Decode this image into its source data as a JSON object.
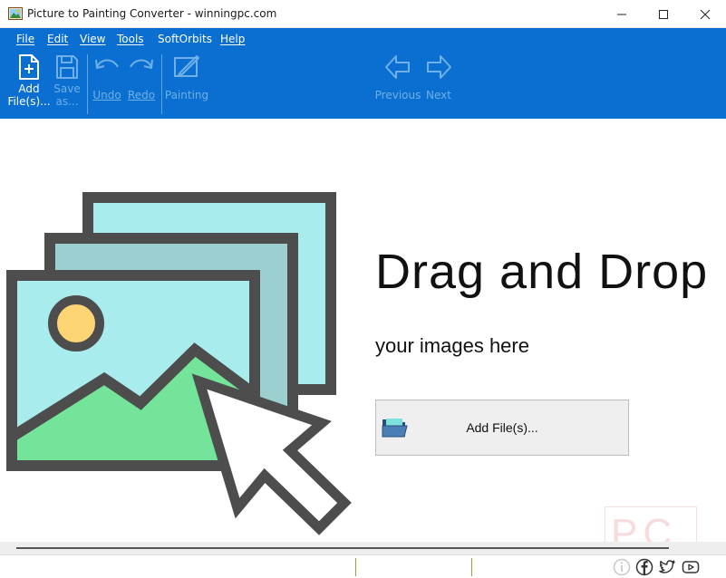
{
  "window": {
    "title": "Picture to Painting Converter - winningpc.com"
  },
  "menu": {
    "items": [
      "File",
      "Edit",
      "View",
      "Tools",
      "SoftOrbits",
      "Help"
    ]
  },
  "toolbar": {
    "add_files": "Add\nFile(s)...",
    "save_as": "Save\nas...",
    "undo": "Undo",
    "redo": "Redo",
    "painting": "Painting",
    "previous": "Previous",
    "next": "Next"
  },
  "main": {
    "drag_title": "Drag and Drop",
    "drag_subtitle": "your images here",
    "add_button_label": "Add File(s)..."
  },
  "watermark": {
    "text": "PC"
  },
  "icons": {
    "app": "app-painting-icon",
    "minimize": "minimize-icon",
    "maximize": "maximize-icon",
    "close": "close-icon",
    "add_file": "add-file-icon",
    "save": "save-icon",
    "undo": "undo-icon",
    "redo": "redo-icon",
    "painting": "painting-icon",
    "previous": "arrow-left-icon",
    "next": "arrow-right-icon",
    "folder": "folder-icon",
    "info": "info-icon",
    "facebook": "facebook-icon",
    "twitter": "twitter-icon",
    "youtube": "youtube-icon"
  },
  "colors": {
    "ribbon": "#0a6fd0",
    "disabled_label": "#6fb0e8"
  }
}
